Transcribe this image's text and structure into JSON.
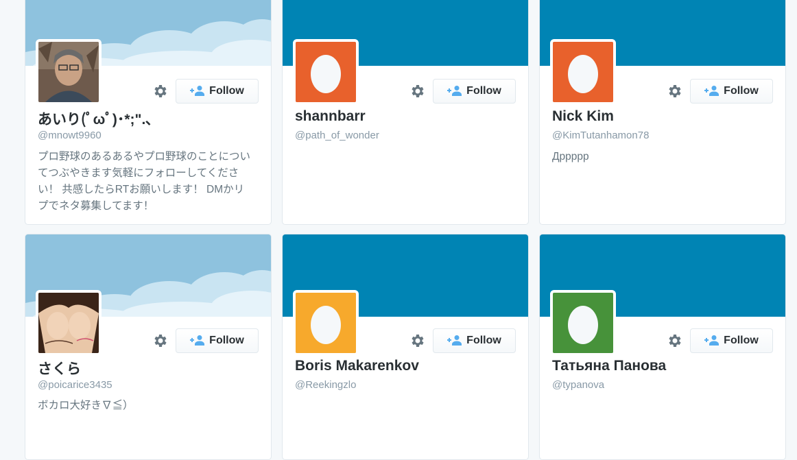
{
  "follow_label": "Follow",
  "cards": [
    {
      "name": "あいり(ﾟωﾟ)･*;\".､",
      "handle": "@mnowt9960",
      "bio": "プロ野球のあるあるやプロ野球のことについてつぶやきます気軽にフォローしてください！ 共感したらRTお願いします！ DMかリプでネタ募集してます！",
      "banner": "sky",
      "avatar": "photo"
    },
    {
      "name": "shannbarr",
      "handle": "@path_of_wonder",
      "bio": "",
      "banner": "blue",
      "avatar": "egg",
      "avatar_color": "#e8612c"
    },
    {
      "name": "Nick Kim",
      "handle": "@KimTutanhamon78",
      "bio": "Дррррр",
      "banner": "blue",
      "avatar": "egg",
      "avatar_color": "#e8612c"
    },
    {
      "name": "さくら",
      "handle": "@poicarice3435",
      "bio": "ボカロ大好き∇≦）",
      "banner": "sky",
      "avatar": "photo"
    },
    {
      "name": "Boris Makarenkov",
      "handle": "@Reekingzlo",
      "bio": "",
      "banner": "blue",
      "avatar": "egg",
      "avatar_color": "#f7a92c"
    },
    {
      "name": "Татьяна Панова",
      "handle": "@typanova",
      "bio": "",
      "banner": "blue",
      "avatar": "egg",
      "avatar_color": "#47923a"
    }
  ],
  "colors": {
    "banner_blue": "#0084b4",
    "banner_sky": "#9ecbe4",
    "follow_icon": "#55acee"
  },
  "icons": {
    "gear": "gear-icon",
    "follow": "person-plus-icon",
    "egg": "egg-icon"
  }
}
